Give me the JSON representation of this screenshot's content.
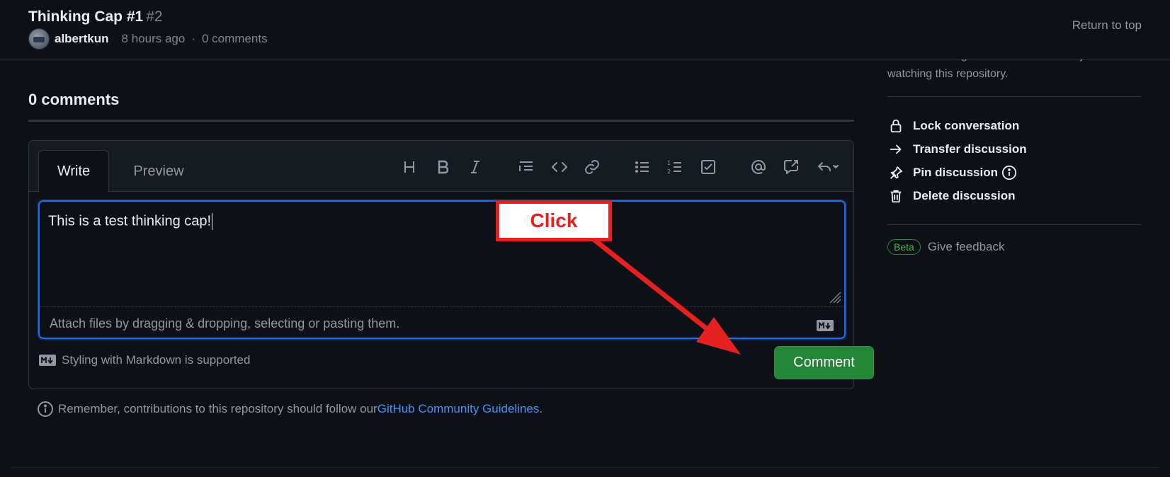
{
  "header": {
    "title": "Thinking Cap #1",
    "number": "#2",
    "author": "albertkun",
    "time_ago": "8 hours ago",
    "separator": "·",
    "comments_count": "0 comments",
    "return_to_top": "Return to top"
  },
  "sidebar": {
    "notification_text": "You're receiving notifications because you're watching this repository.",
    "actions": [
      {
        "label": "Lock conversation",
        "icon": "lock-icon"
      },
      {
        "label": "Transfer discussion",
        "icon": "arrow-right-icon"
      },
      {
        "label": "Pin discussion",
        "icon": "pin-icon"
      },
      {
        "label": "Delete discussion",
        "icon": "trash-icon"
      }
    ],
    "beta_label": "Beta",
    "feedback_label": "Give feedback"
  },
  "main": {
    "comments_heading": "0 comments",
    "editor": {
      "tabs": [
        "Write",
        "Preview"
      ],
      "toolbar_icons": [
        "heading-icon",
        "bold-icon",
        "italic-icon",
        "quote-icon",
        "code-icon",
        "link-icon",
        "unordered-list-icon",
        "ordered-list-icon",
        "task-list-icon",
        "mention-icon",
        "cross-reference-icon",
        "saved-replies-icon"
      ],
      "textarea_value": "This is a test thinking cap!",
      "attach_text": "Attach files by dragging & dropping, selecting or pasting them.",
      "markdown_note": "Styling with Markdown is supported",
      "comment_button": "Comment"
    },
    "guidelines_prefix": "Remember, contributions to this repository should follow our ",
    "guidelines_link": "GitHub Community Guidelines",
    "guidelines_suffix": "."
  },
  "annotation": {
    "callout_text": "Click",
    "color": "#e52020"
  },
  "colors": {
    "background": "#0d1117",
    "accent_blue": "#1f6feb",
    "button_green": "#238636",
    "link": "#4493f8"
  }
}
